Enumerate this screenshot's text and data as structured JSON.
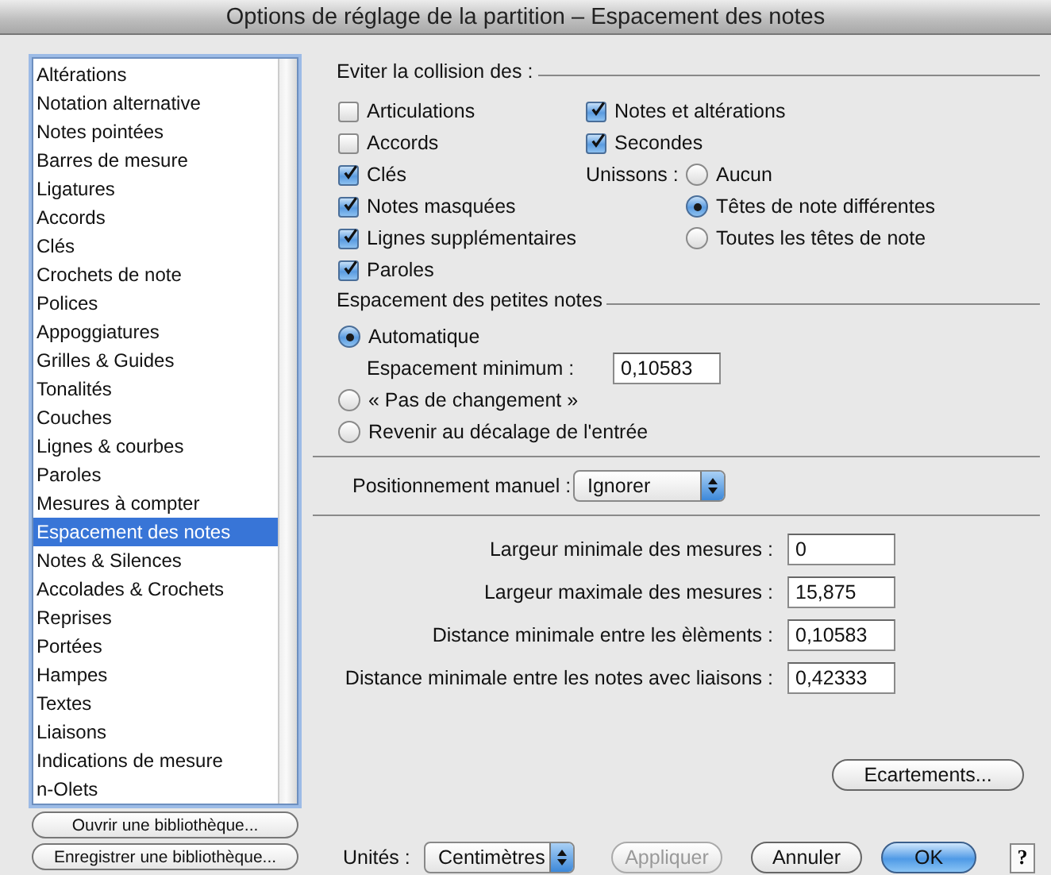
{
  "window": {
    "title": "Options de réglage de la partition – Espacement des notes"
  },
  "sidebar": {
    "items": [
      {
        "label": "Altérations",
        "selected": false
      },
      {
        "label": "Notation alternative",
        "selected": false
      },
      {
        "label": "Notes pointées",
        "selected": false
      },
      {
        "label": "Barres de mesure",
        "selected": false
      },
      {
        "label": "Ligatures",
        "selected": false
      },
      {
        "label": "Accords",
        "selected": false
      },
      {
        "label": "Clés",
        "selected": false
      },
      {
        "label": "Crochets de note",
        "selected": false
      },
      {
        "label": "Polices",
        "selected": false
      },
      {
        "label": "Appoggiatures",
        "selected": false
      },
      {
        "label": "Grilles & Guides",
        "selected": false
      },
      {
        "label": "Tonalités",
        "selected": false
      },
      {
        "label": "Couches",
        "selected": false
      },
      {
        "label": "Lignes & courbes",
        "selected": false
      },
      {
        "label": "Paroles",
        "selected": false
      },
      {
        "label": "Mesures à compter",
        "selected": false
      },
      {
        "label": "Espacement des notes",
        "selected": true
      },
      {
        "label": "Notes & Silences",
        "selected": false
      },
      {
        "label": "Accolades & Crochets",
        "selected": false
      },
      {
        "label": "Reprises",
        "selected": false
      },
      {
        "label": "Portées",
        "selected": false
      },
      {
        "label": "Hampes",
        "selected": false
      },
      {
        "label": "Textes",
        "selected": false
      },
      {
        "label": "Liaisons",
        "selected": false
      },
      {
        "label": "Indications de mesure",
        "selected": false
      },
      {
        "label": "n-Olets",
        "selected": false
      }
    ],
    "buttons": [
      "Ouvrir une bibliothèque...",
      "Enregistrer une bibliothèque..."
    ]
  },
  "collision": {
    "title": "Eviter la collision des :",
    "left": [
      {
        "label": "Articulations",
        "checked": false
      },
      {
        "label": "Accords",
        "checked": false
      },
      {
        "label": "Clés",
        "checked": true
      },
      {
        "label": "Notes masquées",
        "checked": true
      },
      {
        "label": "Lignes supplémentaires",
        "checked": true
      },
      {
        "label": "Paroles",
        "checked": true
      }
    ],
    "right": [
      {
        "label": "Notes et altérations",
        "checked": true
      },
      {
        "label": "Secondes",
        "checked": true
      }
    ],
    "unisons": {
      "label": "Unissons :",
      "options": [
        {
          "label": "Aucun",
          "selected": false
        },
        {
          "label": "Têtes de note différentes",
          "selected": true
        },
        {
          "label": "Toutes les têtes de note",
          "selected": false
        }
      ]
    }
  },
  "grace_notes": {
    "title": "Espacement des petites notes",
    "options": [
      {
        "label": "Automatique",
        "selected": true
      },
      {
        "label": "« Pas de changement »",
        "selected": false
      },
      {
        "label": "Revenir au décalage de l'entrée",
        "selected": false
      }
    ],
    "minimum": {
      "label": "Espacement minimum :",
      "value": "0,10583"
    }
  },
  "manual_positioning": {
    "label": "Positionnement manuel :",
    "value": "Ignorer"
  },
  "fields": [
    {
      "label": "Largeur minimale des mesures :",
      "value": "0"
    },
    {
      "label": "Largeur maximale des mesures :",
      "value": "15,875"
    },
    {
      "label": "Distance minimale entre les èlèments :",
      "value": "0,10583"
    },
    {
      "label": "Distance minimale entre les notes avec liaisons :",
      "value": "0,42333"
    }
  ],
  "spacing_button": "Ecartements...",
  "footer": {
    "units_label": "Unités :",
    "units_value": "Centimètres",
    "buttons": [
      {
        "label": "Appliquer",
        "disabled": true,
        "default": false
      },
      {
        "label": "Annuler",
        "disabled": false,
        "default": false
      },
      {
        "label": "OK",
        "disabled": false,
        "default": true
      }
    ],
    "help": "?"
  }
}
